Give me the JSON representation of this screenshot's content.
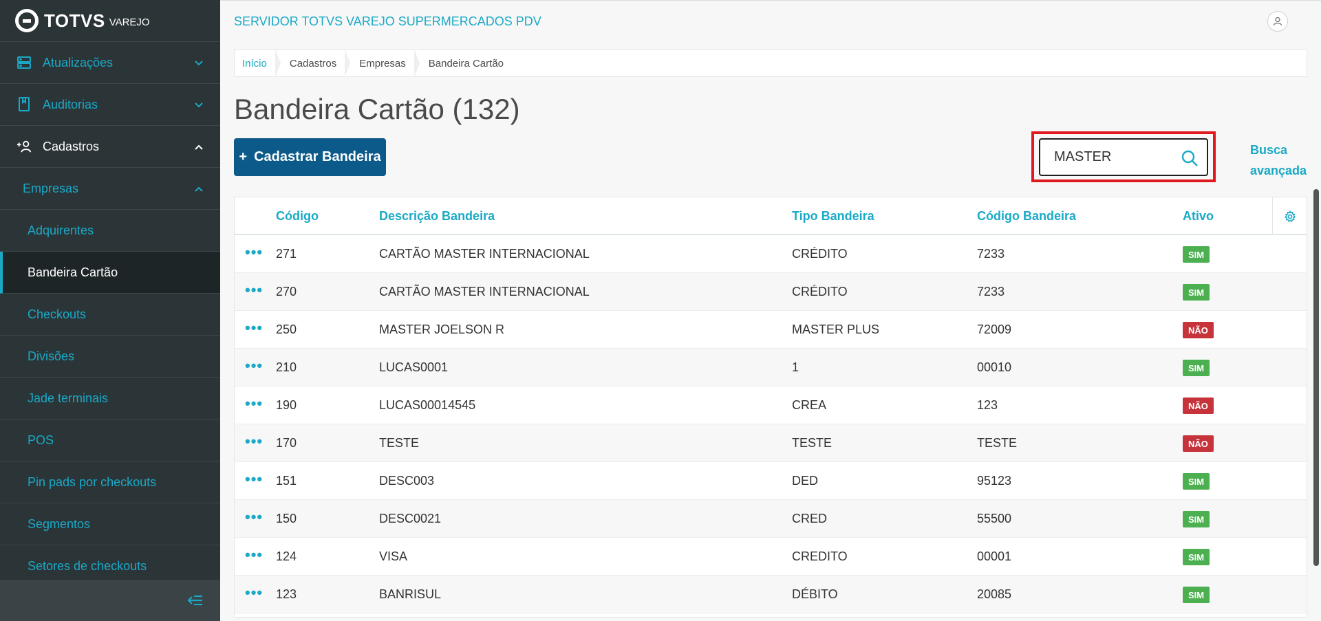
{
  "brand": {
    "name": "TOTVS",
    "sub": "VAREJO"
  },
  "app_title": "SERVIDOR TOTVS VAREJO SUPERMERCADOS PDV",
  "sidebar": {
    "items": [
      {
        "label": "Atualizações",
        "icon": "server-icon"
      },
      {
        "label": "Auditorias",
        "icon": "book-icon"
      },
      {
        "label": "Cadastros",
        "icon": "add-user-icon"
      },
      {
        "label": "Empresas"
      },
      {
        "label": "Adquirentes"
      },
      {
        "label": "Bandeira Cartão"
      },
      {
        "label": "Checkouts"
      },
      {
        "label": "Divisões"
      },
      {
        "label": "Jade terminais"
      },
      {
        "label": "POS"
      },
      {
        "label": "Pin pads por checkouts"
      },
      {
        "label": "Segmentos"
      },
      {
        "label": "Setores de checkouts"
      }
    ]
  },
  "breadcrumb": [
    "Início",
    "Cadastros",
    "Empresas",
    "Bandeira Cartão"
  ],
  "page_title": "Bandeira Cartão (132)",
  "add_button": {
    "plus": "+",
    "label": "Cadastrar Bandeira"
  },
  "search": {
    "value": "MASTER",
    "placeholder": ""
  },
  "advanced_search": "Busca avançada",
  "table": {
    "columns": [
      "Código",
      "Descrição Bandeira",
      "Tipo Bandeira",
      "Código Bandeira",
      "Ativo"
    ],
    "rows": [
      {
        "actions": "•••",
        "codigo": "271",
        "descricao": "CARTÃO MASTER INTERNACIONAL",
        "tipo": "CRÉDITO",
        "codigo_bandeira": "7233",
        "ativo": "SIM"
      },
      {
        "actions": "•••",
        "codigo": "270",
        "descricao": "CARTÃO MASTER INTERNACIONAL",
        "tipo": "CRÉDITO",
        "codigo_bandeira": "7233",
        "ativo": "SIM"
      },
      {
        "actions": "•••",
        "codigo": "250",
        "descricao": "MASTER JOELSON R",
        "tipo": "MASTER PLUS",
        "codigo_bandeira": "72009",
        "ativo": "NÃO"
      },
      {
        "actions": "•••",
        "codigo": "210",
        "descricao": "LUCAS0001",
        "tipo": "1",
        "codigo_bandeira": "00010",
        "ativo": "SIM"
      },
      {
        "actions": "•••",
        "codigo": "190",
        "descricao": "LUCAS00014545",
        "tipo": "CREA",
        "codigo_bandeira": "123",
        "ativo": "NÃO"
      },
      {
        "actions": "•••",
        "codigo": "170",
        "descricao": "TESTE",
        "tipo": "TESTE",
        "codigo_bandeira": "TESTE",
        "ativo": "NÃO"
      },
      {
        "actions": "•••",
        "codigo": "151",
        "descricao": "DESC003",
        "tipo": "DED",
        "codigo_bandeira": "95123",
        "ativo": "SIM"
      },
      {
        "actions": "•••",
        "codigo": "150",
        "descricao": "DESC0021",
        "tipo": "CRED",
        "codigo_bandeira": "55500",
        "ativo": "SIM"
      },
      {
        "actions": "•••",
        "codigo": "124",
        "descricao": "VISA",
        "tipo": "CREDITO",
        "codigo_bandeira": "00001",
        "ativo": "SIM"
      },
      {
        "actions": "•••",
        "codigo": "123",
        "descricao": "BANRISUL",
        "tipo": "DÉBITO",
        "codigo_bandeira": "20085",
        "ativo": "SIM"
      }
    ]
  },
  "colors": {
    "accent": "#1aa9c6",
    "primary": "#0c5a8a",
    "sidebar": "#2b3437",
    "yes": "#4caf50",
    "no": "#c6333b",
    "highlight": "#e0191f"
  }
}
